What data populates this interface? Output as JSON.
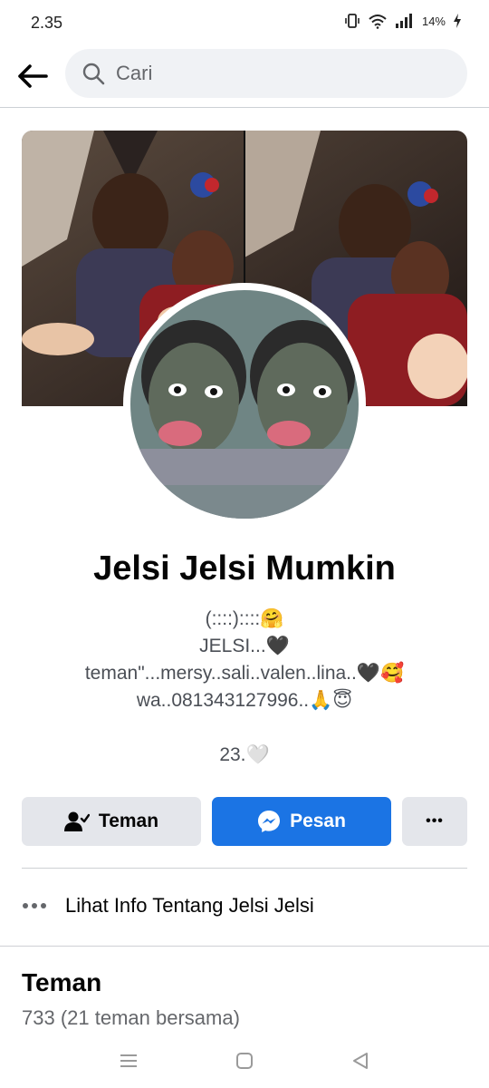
{
  "status": {
    "time": "2.35",
    "battery": "14%"
  },
  "search": {
    "placeholder": "Cari"
  },
  "profile": {
    "name": "Jelsi Jelsi Mumkin",
    "bio": [
      "(::::)::::🤗",
      "JELSI...🖤",
      "teman\"...mersy..sali..valen..lina..🖤🥰",
      "wa..081343127996..🙏😇"
    ],
    "age_line": "23.🤍"
  },
  "actions": {
    "friend_label": "Teman",
    "message_label": "Pesan",
    "more_label": "•••"
  },
  "info": {
    "label": "Lihat Info Tentang Jelsi Jelsi"
  },
  "friends": {
    "title": "Teman",
    "count": "733 (21 teman bersama)"
  },
  "colors": {
    "accent": "#1b74e4",
    "button_gray": "#e4e6eb",
    "secondary_text": "#65676b"
  },
  "icons": [
    "vibrate-icon",
    "wifi-icon",
    "signal-icon",
    "battery-charging-icon",
    "back-arrow-icon",
    "search-icon",
    "friend-check-icon",
    "messenger-icon",
    "more-dots-icon",
    "recent-apps-icon",
    "home-icon",
    "back-triangle-icon"
  ]
}
